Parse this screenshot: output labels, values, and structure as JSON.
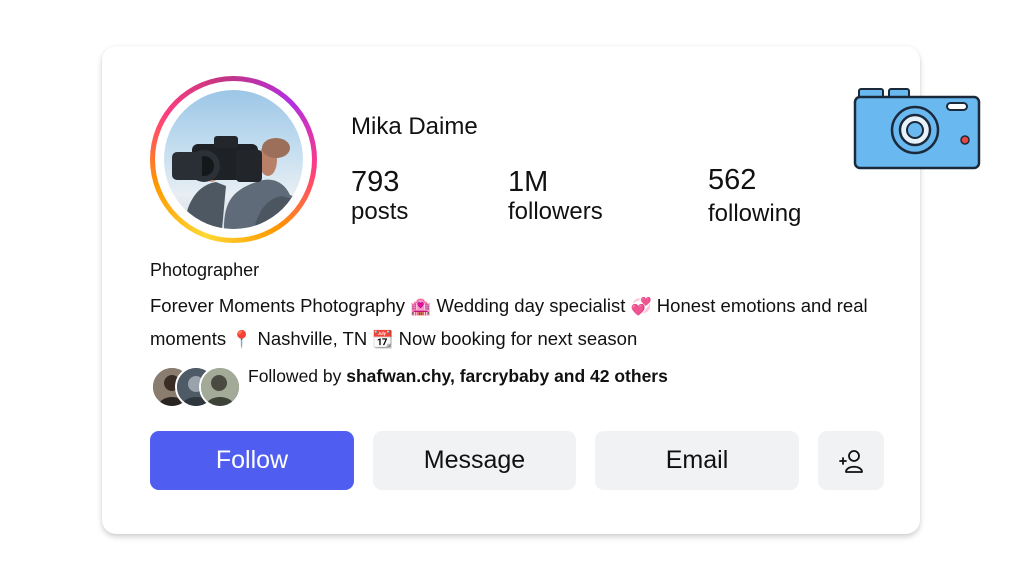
{
  "profile": {
    "name": "Mika Daime",
    "stats": [
      {
        "value": "793",
        "label": "posts"
      },
      {
        "value": "1M",
        "label": "followers"
      },
      {
        "value": "562",
        "label": "following"
      }
    ],
    "category": "Photographer",
    "bio": {
      "part1": "Forever Moments Photography ",
      "icon1": "🏩",
      "part2": " Wedding day specialist ",
      "icon2": "💞",
      "part3": " Honest emotions and real moments ",
      "icon3": "📍",
      "part4": " Nashville, TN ",
      "icon4": "📆",
      "part5": " Now booking for next season"
    }
  },
  "followed_by": {
    "prefix": "Followed by ",
    "names": "shafwan.chy, farcrybaby and 42 others"
  },
  "actions": {
    "follow": "Follow",
    "message": "Message",
    "email": "Email"
  },
  "icons": {
    "avatar": "photographer-with-camera",
    "add_friend": "add-person-icon",
    "decoration": "camera-icon"
  },
  "colors": {
    "follow_button": "#4f5df0",
    "secondary_button": "#f1f2f4",
    "camera_body": "#6ab8f0"
  }
}
